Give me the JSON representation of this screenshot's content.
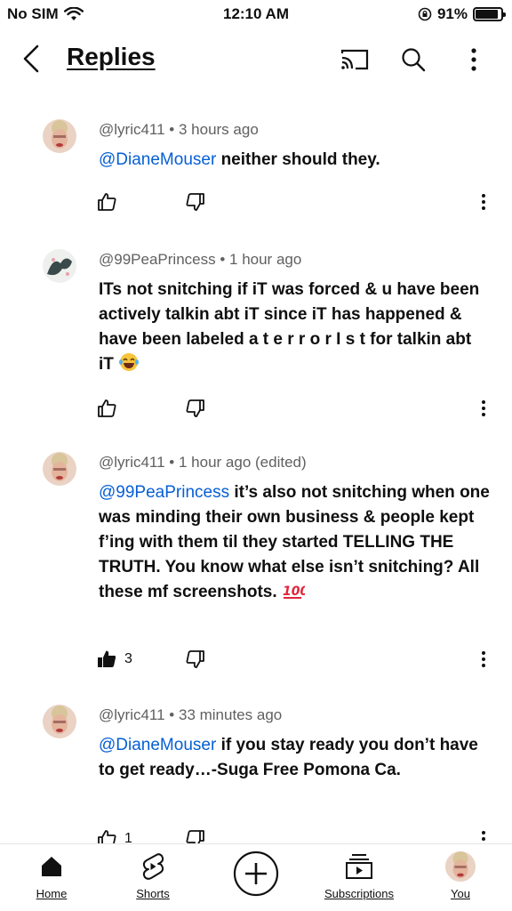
{
  "status_bar": {
    "carrier": "No SIM",
    "time": "12:10 AM",
    "battery": "91%",
    "battery_level": 0.91
  },
  "header": {
    "title": "Replies"
  },
  "comments": [
    {
      "author": "@lyric411",
      "time": "3 hours ago",
      "mention": "@DianeMouser",
      "text": " neither should they.",
      "likes": ""
    },
    {
      "author": "@99PeaPrincess",
      "time": "1 hour ago",
      "mention": "",
      "text": "ITs not snitching if iT was forced & u have been actively talkin abt iT since iT has happened & have been labeled a t e r r o r I s t for talkin abt iT",
      "likes": ""
    },
    {
      "author": "@lyric411",
      "time": "1 hour ago (edited)",
      "mention": "@99PeaPrincess",
      "text": " it’s also not snitching when one was minding their own business & people kept f’ing with them til they started TELLING THE TRUTH. You know what else isn’t snitching? All these mf screenshots.",
      "likes": "3"
    },
    {
      "author": "@lyric411",
      "time": "33 minutes ago",
      "mention": "@DianeMouser",
      "text": " if you stay ready you don’t have to get ready…-Suga Free Pomona Ca.",
      "likes": "1"
    }
  ],
  "nav": {
    "home": "Home",
    "shorts": "Shorts",
    "subscriptions": "Subscriptions",
    "you": "You"
  },
  "colors": {
    "mention": "#065fd4",
    "meta": "#606060",
    "text": "#0f0f0f"
  }
}
